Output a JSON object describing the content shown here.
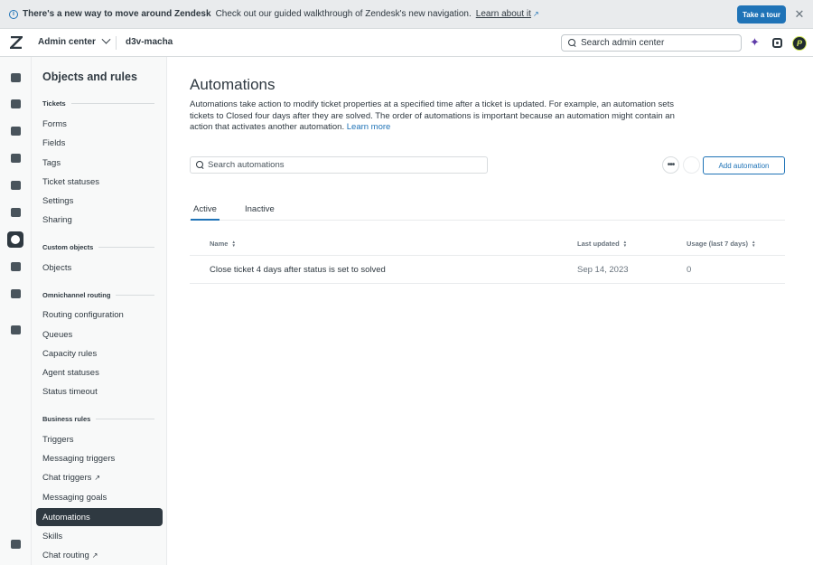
{
  "banner": {
    "title": "There's a new way to move around Zendesk",
    "message": "Check out our guided walkthrough of Zendesk's new navigation.",
    "link": "Learn about it",
    "tour_button": "Take a tour"
  },
  "topbar": {
    "product": "Admin center",
    "subdomain": "d3v-macha",
    "search_placeholder": "Search admin center",
    "avatar_initial": "P"
  },
  "nav": {
    "title": "Objects and rules",
    "sections": {
      "tickets": "Tickets",
      "custom_objects": "Custom objects",
      "omnichannel": "Omnichannel routing",
      "business_rules": "Business rules"
    },
    "items": {
      "forms": "Forms",
      "fields": "Fields",
      "tags": "Tags",
      "ticket_statuses": "Ticket statuses",
      "settings": "Settings",
      "sharing": "Sharing",
      "objects": "Objects",
      "routing_configuration": "Routing configuration",
      "queues": "Queues",
      "capacity_rules": "Capacity rules",
      "agent_statuses": "Agent statuses",
      "status_timeout": "Status timeout",
      "triggers": "Triggers",
      "messaging_triggers": "Messaging triggers",
      "chat_triggers": "Chat triggers",
      "messaging_goals": "Messaging goals",
      "automations": "Automations",
      "skills": "Skills",
      "chat_routing": "Chat routing"
    }
  },
  "main": {
    "title": "Automations",
    "description": "Automations take action to modify ticket properties at a specified time after a ticket is updated. For example, an automation sets tickets to Closed four days after they are solved. The order of automations is important because an automation might contain an action that activates another automation.",
    "learn_more": "Learn more",
    "search_placeholder": "Search automations",
    "add_button": "Add automation",
    "tabs": {
      "active": "Active",
      "inactive": "Inactive"
    },
    "table": {
      "headers": {
        "name": "Name",
        "last_updated": "Last updated",
        "usage": "Usage (last 7 days)"
      },
      "rows": [
        {
          "name": "Close ticket 4 days after status is set to solved",
          "last_updated": "Sep 14, 2023",
          "usage": "0"
        }
      ]
    }
  },
  "colors": {
    "accent": "#1f73b7",
    "dark": "#2f3941"
  }
}
